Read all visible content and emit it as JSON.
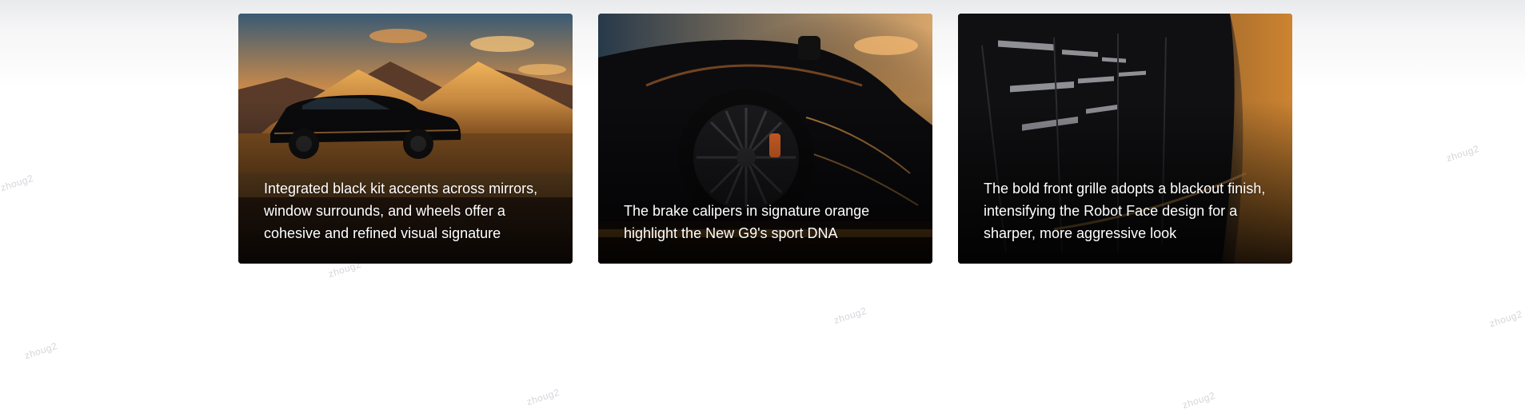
{
  "watermark_text": "zhoug2",
  "cards": [
    {
      "image_icon": "suv-desert-scene-image",
      "caption": "Integrated black kit accents across mirrors, window surrounds, and wheels offer a cohesive and refined visual signature"
    },
    {
      "image_icon": "wheel-brake-caliper-image",
      "caption": "The brake calipers in signature orange highlight the New G9's sport DNA"
    },
    {
      "image_icon": "front-grille-closeup-image",
      "caption": "The bold front grille adopts a blackout finish, intensifying the Robot Face design for a sharper, more aggressive look"
    }
  ],
  "colors": {
    "accent_orange": "#e89a3a",
    "card_dark": "#0d0d0f",
    "caption_text": "#ffffff"
  }
}
